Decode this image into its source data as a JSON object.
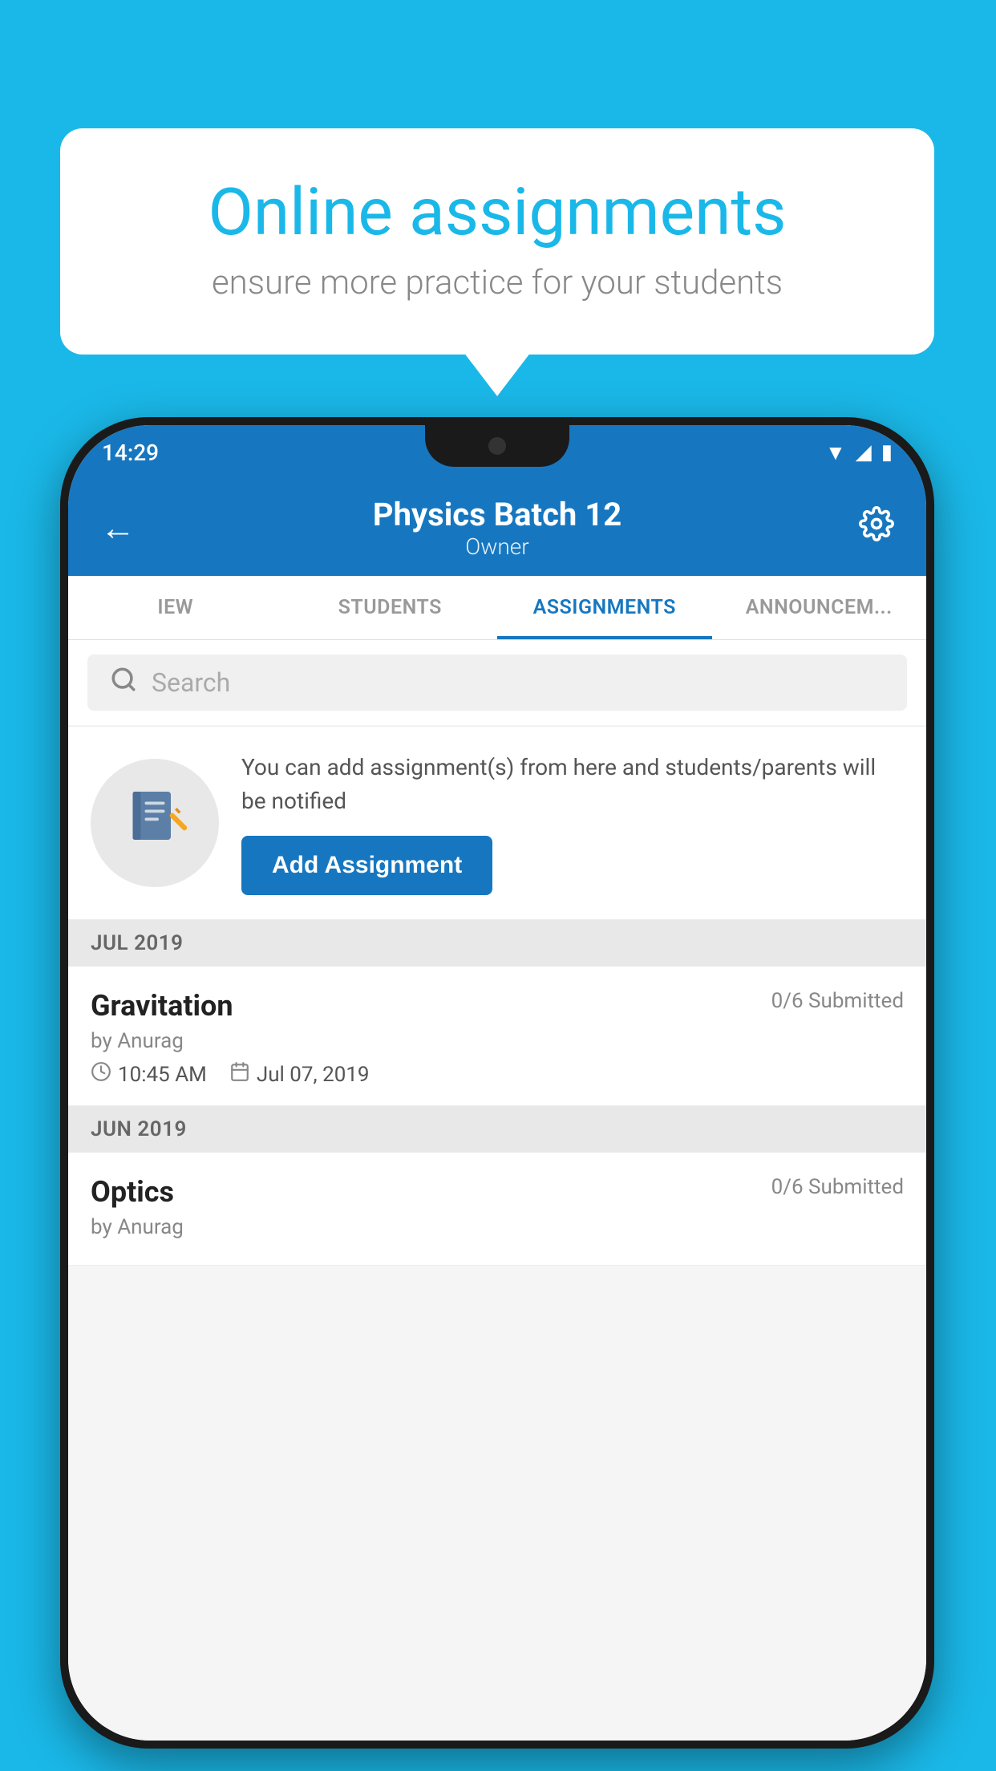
{
  "background_color": "#1ab8e8",
  "speech_bubble": {
    "title": "Online assignments",
    "subtitle": "ensure more practice for your students"
  },
  "phone": {
    "status_bar": {
      "time": "14:29",
      "icons": [
        "wifi",
        "signal",
        "battery"
      ]
    },
    "header": {
      "title": "Physics Batch 12",
      "subtitle": "Owner",
      "back_label": "←",
      "settings_label": "⚙"
    },
    "tabs": [
      {
        "label": "IEW",
        "active": false
      },
      {
        "label": "STUDENTS",
        "active": false
      },
      {
        "label": "ASSIGNMENTS",
        "active": true
      },
      {
        "label": "ANNOUNCEM...",
        "active": false
      }
    ],
    "search": {
      "placeholder": "Search"
    },
    "promo": {
      "text": "You can add assignment(s) from here and students/parents will be notified",
      "button_label": "Add Assignment"
    },
    "sections": [
      {
        "header": "JUL 2019",
        "assignments": [
          {
            "name": "Gravitation",
            "submitted": "0/6 Submitted",
            "by": "by Anurag",
            "time": "10:45 AM",
            "date": "Jul 07, 2019"
          }
        ]
      },
      {
        "header": "JUN 2019",
        "assignments": [
          {
            "name": "Optics",
            "submitted": "0/6 Submitted",
            "by": "by Anurag",
            "time": "",
            "date": ""
          }
        ]
      }
    ]
  }
}
